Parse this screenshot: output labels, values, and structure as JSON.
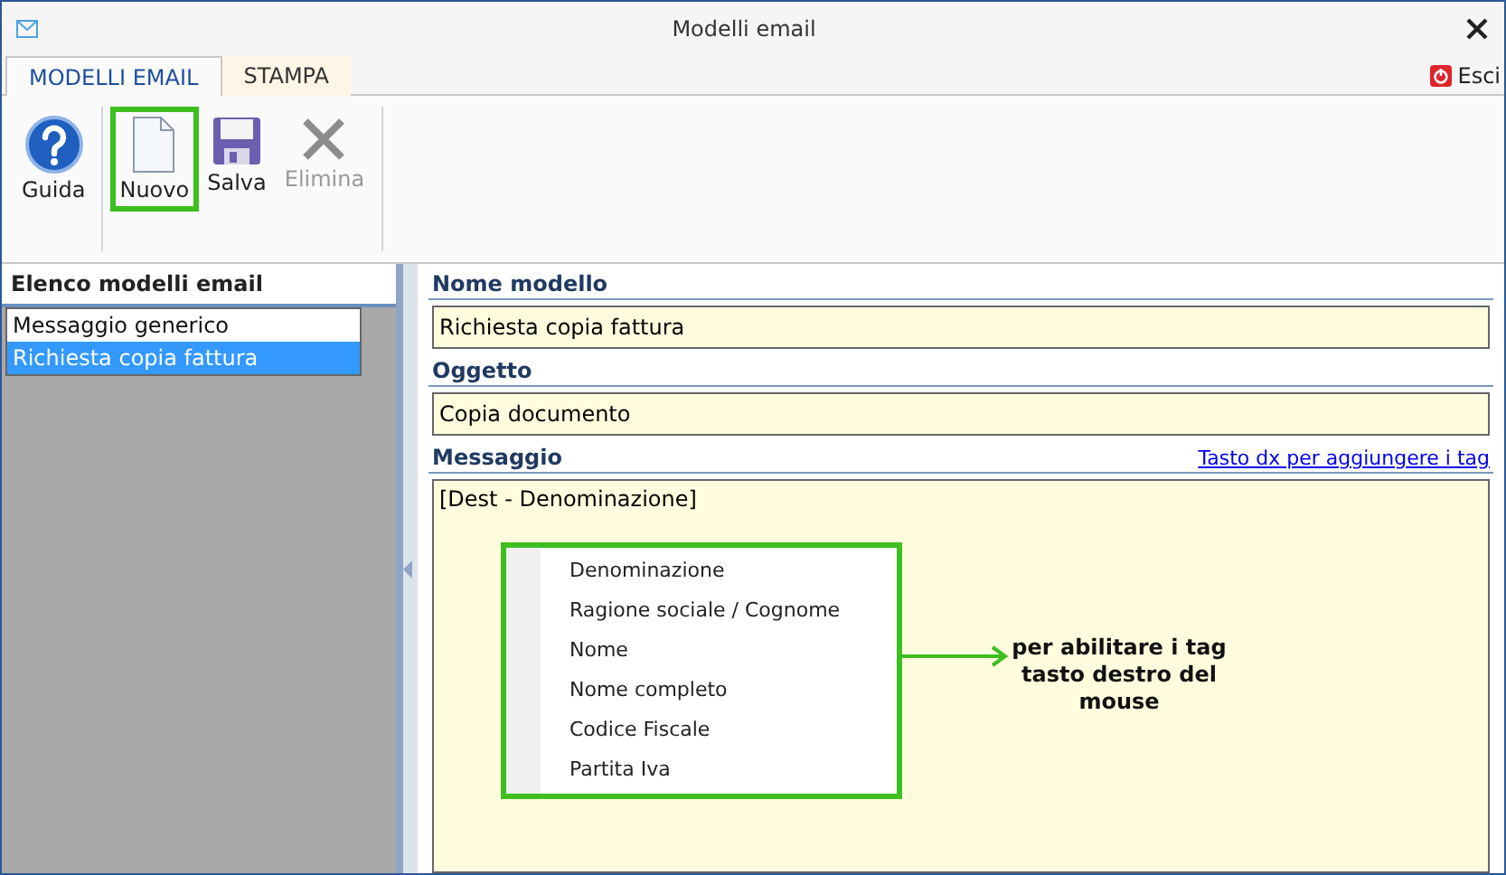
{
  "window": {
    "title": "Modelli email"
  },
  "tabs": [
    {
      "label": "MODELLI EMAIL",
      "selected": true
    },
    {
      "label": "STAMPA",
      "selected": false
    }
  ],
  "exit_button": {
    "label": "Esci"
  },
  "toolbar": [
    {
      "kind": "help",
      "label": "Guida",
      "disabled": false,
      "highlighted": false
    },
    {
      "kind": "new",
      "label": "Nuovo",
      "disabled": false,
      "highlighted": true
    },
    {
      "kind": "save",
      "label": "Salva",
      "disabled": false,
      "highlighted": false
    },
    {
      "kind": "delete",
      "label": "Elimina",
      "disabled": true,
      "highlighted": false
    }
  ],
  "sidebar": {
    "title": "Elenco modelli email",
    "items": [
      {
        "label": "Messaggio generico",
        "selected": false
      },
      {
        "label": "Richiesta copia fattura",
        "selected": true
      }
    ]
  },
  "form": {
    "name_label": "Nome modello",
    "name_value": "Richiesta copia fattura",
    "subject_label": "Oggetto",
    "subject_value": "Copia documento",
    "message_label": "Messaggio",
    "tag_link": "Tasto dx per aggiungere i tag",
    "message_value": "[Dest - Denominazione]"
  },
  "context_menu": {
    "highlighted": true,
    "items": [
      "Denominazione",
      "Ragione sociale / Cognome",
      "Nome",
      "Nome completo",
      "Codice Fiscale",
      "Partita Iva"
    ]
  },
  "callout": {
    "text": "per abilitare i tag tasto destro del mouse"
  }
}
